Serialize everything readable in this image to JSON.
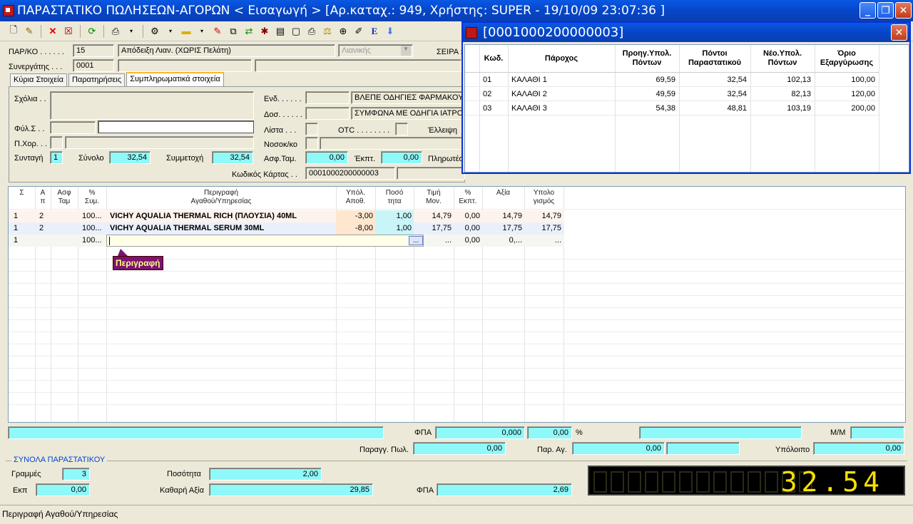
{
  "window": {
    "title": "ΠΑΡΑΣΤΑΤΙΚΟ ΠΩΛΗΣΕΩΝ-ΑΓΟΡΩΝ < Εισαγωγή > [Αρ.καταχ.: 949, Χρήστης: SUPER - 19/10/09 23:07:36 ]",
    "min": "_",
    "max": "❐",
    "close": "✕"
  },
  "header": {
    "parko_label": "ΠΑΡ/ΚΟ . . . . . .",
    "parko_code": "15",
    "parko_desc": "Απόδειξη Λιαν. (ΧΩΡΙΣ Πελάτη)",
    "parko_type": "Λιανικής",
    "seira_label": "ΣΕΙΡΑ :",
    "synergatis_label": "Συνεργάτης . . .",
    "synergatis_code": "0001"
  },
  "tabs": [
    "Κύρια Στοιχεία",
    "Παρατηρήσεις",
    "Συμπληρωματικά στοιχεία"
  ],
  "panel": {
    "sxolia_label": "Σχόλια . .",
    "fylo_label": "Φύλ.Σ . .",
    "pxor_label": "Π.Χορ. . .",
    "syntagi_label": "Συνταγή",
    "syntagi_value": "1",
    "synolo_label": "Σύνολο",
    "synolo_value": "32,54",
    "symmetoxi_label": "Συμμετοχή",
    "symmetoxi_value": "32,54",
    "end_label": "Ενδ. . . . . .",
    "end_value": "ΒΛΕΠΕ ΟΔΗΓΙΕΣ ΦΑΡΜΑΚΟΥ...",
    "dos_label": "Δοσ. . . . . .",
    "dos_value": "ΣΥΜΦΩΝΑ ΜΕ ΟΔΗΓΙΑ ΙΑΤΡΟΥ",
    "lista_label": "Λίστα . . .",
    "otc_label": "OTC . . . . . . . .",
    "elleipsi_label": "Έλλειψη",
    "nosok_label": "Νοσοκ/κο",
    "asftam_label": "Ασφ.Ταμ.",
    "asftam_value": "0,00",
    "ekpt_label": "Έκπτ.",
    "ekpt_value": "0,00",
    "pliroteo_label": "Πληρωτέο",
    "kartas_label": "Κωδικός Κάρτας . .",
    "kartas_value": "0001000200000003"
  },
  "grid": {
    "headers": [
      {
        "l1": "Σ",
        "l2": ""
      },
      {
        "l1": "Α",
        "l2": "π"
      },
      {
        "l1": "Ασφ",
        "l2": "Ταμ"
      },
      {
        "l1": "%",
        "l2": "Συμ."
      },
      {
        "l1": "Περιγραφή",
        "l2": "Αγαθού/Υπηρεσίας"
      },
      {
        "l1": "Υπόλ.",
        "l2": "Αποθ."
      },
      {
        "l1": "Ποσό",
        "l2": "τητα"
      },
      {
        "l1": "Τιμή",
        "l2": "Μον."
      },
      {
        "l1": "%",
        "l2": "Εκπτ."
      },
      {
        "l1": "Αξία",
        "l2": ""
      },
      {
        "l1": "Υπολο",
        "l2": "γισμός"
      }
    ],
    "rows": [
      {
        "s": "1",
        "ap": "2",
        "asf": "",
        "sym": "100...",
        "desc": "VICHY AQUALIA THERMAL RICH (ΠΛΟΥΣΙΑ) 40ML",
        "stock": "-3,00",
        "qty": "1,00",
        "price": "14,79",
        "disc": "0,00",
        "value": "14,79",
        "calc": "14,79"
      },
      {
        "s": "1",
        "ap": "2",
        "asf": "",
        "sym": "100...",
        "desc": "VICHY AQUALIA THERMAL SERUM 30ML",
        "stock": "-8,00",
        "qty": "1,00",
        "price": "17,75",
        "disc": "0,00",
        "value": "17,75",
        "calc": "17,75"
      },
      {
        "s": "1",
        "ap": "",
        "asf": "",
        "sym": "100...",
        "desc": "",
        "stock": "",
        "qty": "...",
        "price": "...",
        "disc": "0,00",
        "value": "0,...",
        "calc": "..."
      }
    ],
    "tooltip": "Περιγραφή",
    "browse_btn": "..."
  },
  "footer": {
    "fpa_label": "ΦΠΑ",
    "fpa_value": "0,000",
    "fpa_pct": "0,00",
    "pct_sign": "%",
    "mm_label": "Μ/Μ",
    "paragg_label": "Παραγγ. Πωλ.",
    "paragg_value": "0,00",
    "parag_label": "Παρ. Αγ.",
    "parag_value": "0,00",
    "ypoloipo_label": "Υπόλοιπο",
    "ypoloipo_value": "0,00"
  },
  "totals": {
    "title": "ΣΥΝΟΛΑ ΠΑΡΑΣΤΑΤΙΚΟΥ",
    "grammes_label": "Γραμμές",
    "grammes_value": "3",
    "ekp_label": "Εκπ",
    "ekp_value": "0,00",
    "posotita_label": "Ποσότητα",
    "posotita_value": "2,00",
    "kathari_label": "Καθαρή Αξία",
    "kathari_value": "29,85",
    "fpa_label": "ΦΠΑ",
    "fpa_value": "2,69",
    "display": "32.54"
  },
  "status": "Περιγραφή Αγαθού/Υπηρεσίας",
  "popup": {
    "title": "[0001000200000003]",
    "close": "✕",
    "headers": [
      "Κωδ.",
      "Πάροχος",
      "Προηγ.Υπολ. Πόντων",
      "Πόντοι Παραστατικού",
      "Νέο.Υπολ. Πόντων",
      "Όριο Εξαργύρωσης"
    ],
    "rows": [
      {
        "code": "01",
        "provider": "ΚΑΛΑΘΙ 1",
        "prev": "69,59",
        "points": "32,54",
        "new": "102,13",
        "limit": "100,00"
      },
      {
        "code": "02",
        "provider": "ΚΑΛΑΘΙ 2",
        "prev": "49,59",
        "points": "32,54",
        "new": "82,13",
        "limit": "120,00"
      },
      {
        "code": "03",
        "provider": "ΚΑΛΑΘΙ 3",
        "prev": "54,38",
        "points": "48,81",
        "new": "103,19",
        "limit": "200,00"
      }
    ]
  }
}
